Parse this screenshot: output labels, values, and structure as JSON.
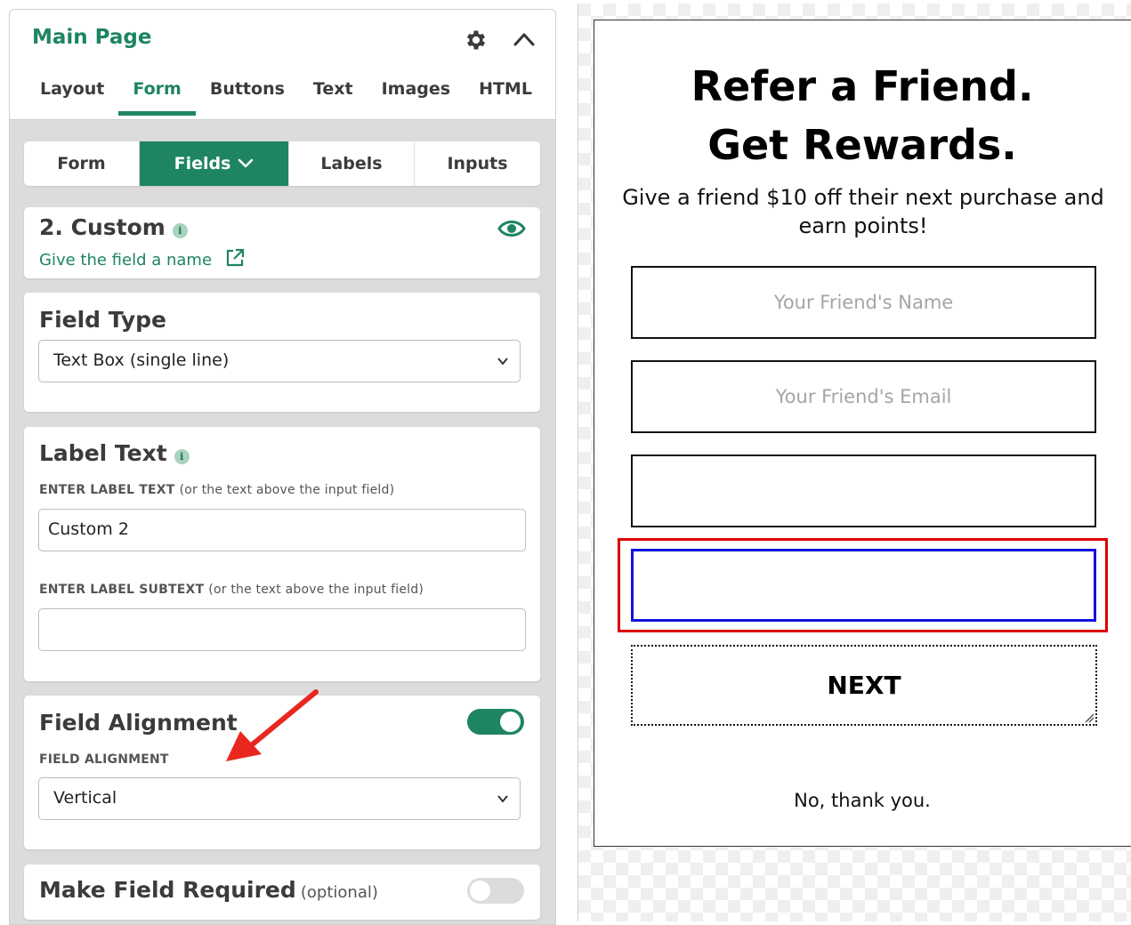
{
  "panel": {
    "title": "Main Page",
    "tabs": [
      "Layout",
      "Form",
      "Buttons",
      "Text",
      "Images",
      "HTML"
    ],
    "active_tab": "Form",
    "subtabs": [
      "Form",
      "Fields",
      "Labels",
      "Inputs"
    ],
    "active_subtab": "Fields",
    "field": {
      "heading": "2. Custom",
      "name_link": "Give the field a name"
    },
    "field_type": {
      "heading": "Field Type",
      "selected": "Text Box (single line)"
    },
    "label_text": {
      "heading": "Label Text",
      "label_caption": "ENTER LABEL TEXT",
      "label_hint": "(or the text above the input field)",
      "label_value": "Custom 2",
      "subtext_caption": "ENTER LABEL SUBTEXT",
      "subtext_hint": "(or the text above the input field)",
      "subtext_value": ""
    },
    "field_alignment": {
      "heading": "Field Alignment",
      "caption": "FIELD ALIGNMENT",
      "selected": "Vertical",
      "enabled": true
    },
    "required": {
      "heading": "Make Field Required",
      "hint": "(optional)",
      "enabled": false
    }
  },
  "preview": {
    "title_line1": "Refer a Friend.",
    "title_line2": "Get Rewards.",
    "subtitle": "Give a friend $10 off their next purchase and earn points!",
    "field1_placeholder": "Your Friend's Name",
    "field2_placeholder": "Your Friend's Email",
    "field3_placeholder": "",
    "field4_placeholder": "",
    "next_button": "NEXT",
    "decline_link": "No, thank you."
  },
  "colors": {
    "accent": "#1e8560",
    "highlight_outer": "#dd0000",
    "highlight_inner": "#1111dd",
    "arrow": "#e8281e"
  }
}
